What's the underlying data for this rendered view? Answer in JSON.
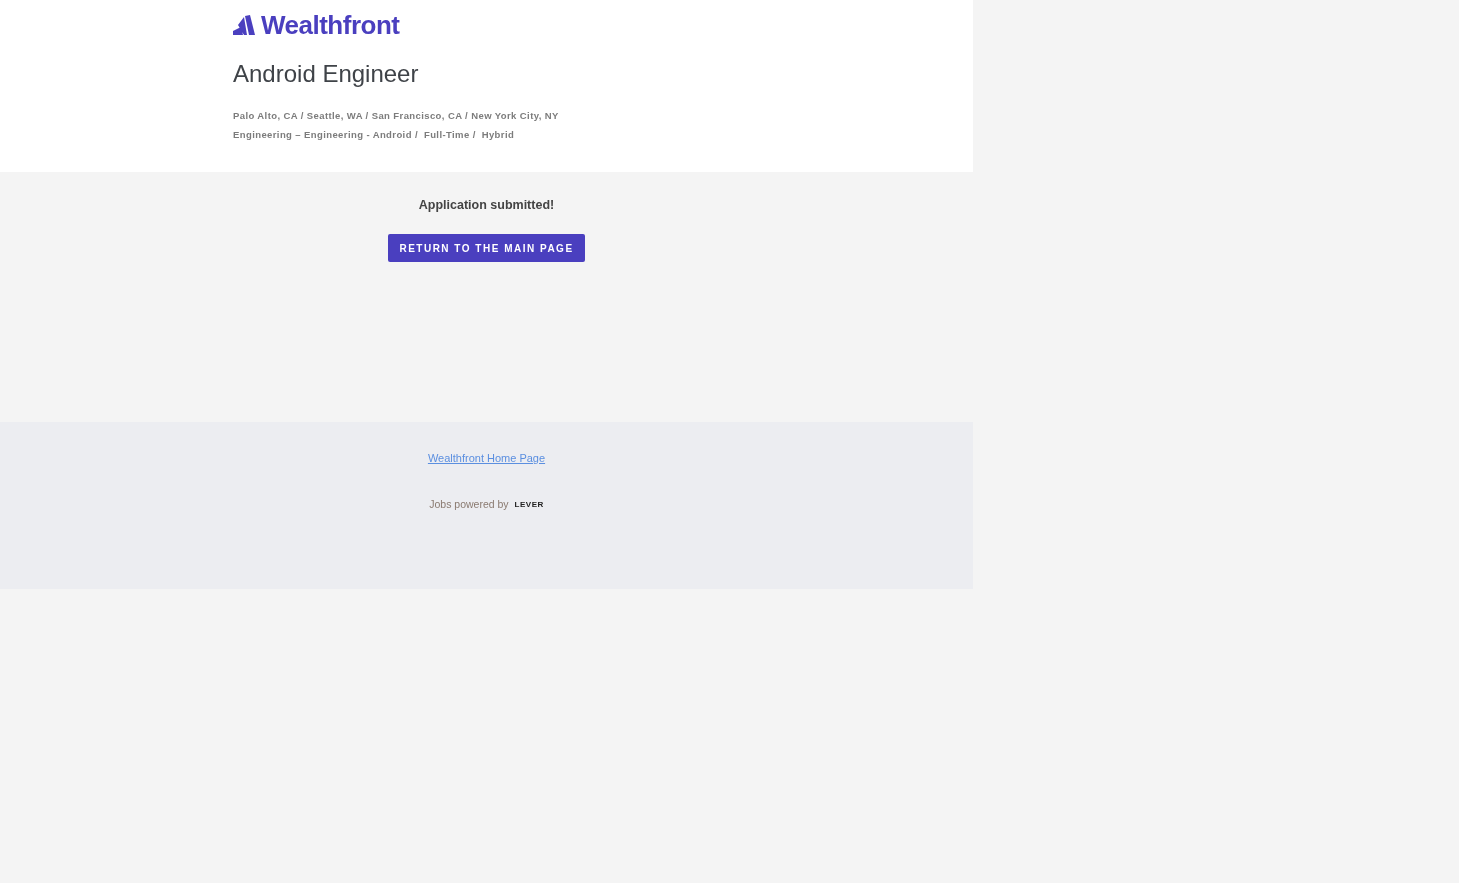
{
  "logo": {
    "text": "Wealthfront"
  },
  "posting": {
    "title": "Android Engineer",
    "location": "Palo Alto, CA / Seattle, WA / San Francisco, CA / New York City, NY",
    "categories": [
      "Engineering – Engineering - Android /",
      "Full-Time /",
      "Hybrid"
    ]
  },
  "confirmation": {
    "message": "Application submitted!",
    "button": "RETURN TO THE MAIN PAGE"
  },
  "footer": {
    "link": "Wealthfront Home Page",
    "powered_by": "Jobs powered by",
    "brand": "LEVER"
  }
}
